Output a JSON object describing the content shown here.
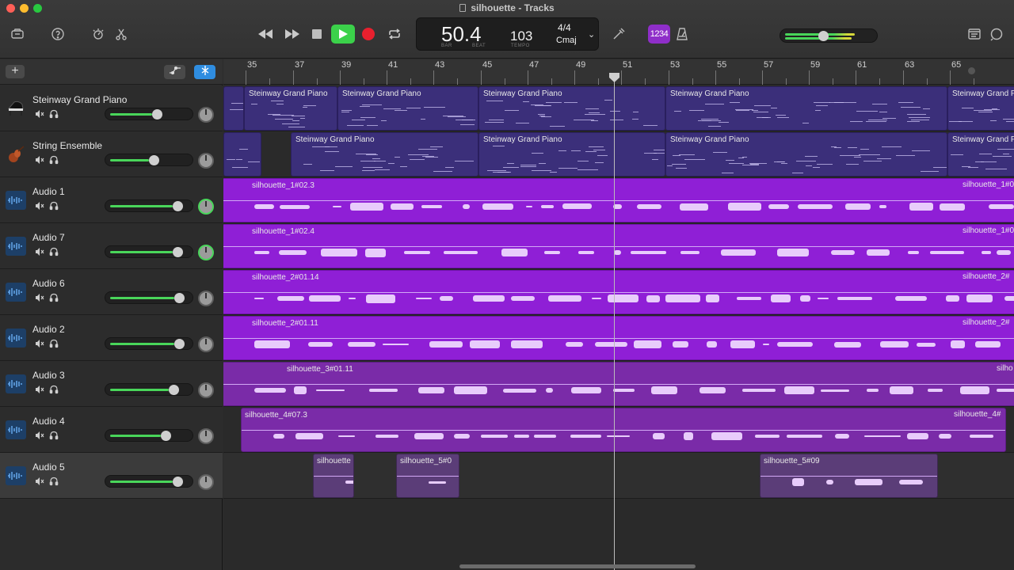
{
  "window": {
    "title": "silhouette - Tracks"
  },
  "colors": {
    "accent_green": "#3bd14a",
    "record_red": "#e8202e",
    "audio_region": "#8f1fd6",
    "midi_region": "#3b2f7a",
    "smart_blue": "#2f8de0"
  },
  "toolbar": {
    "lcd": {
      "position": "50.4",
      "bar_label": "BAR",
      "beat_label": "BEAT",
      "tempo": "103",
      "tempo_label": "TEMPO",
      "time_signature": "4/4",
      "key": "Cmaj"
    },
    "count_in": "1234",
    "master_volume": 0.4
  },
  "ruler": {
    "bars": [
      "35",
      "37",
      "39",
      "41",
      "43",
      "45",
      "47",
      "49",
      "51",
      "53",
      "55",
      "57",
      "59",
      "61",
      "63",
      "65"
    ]
  },
  "tracks": [
    {
      "name": "Steinway Grand Piano",
      "type": "piano",
      "volume": 0.6
    },
    {
      "name": "String Ensemble",
      "type": "strings",
      "volume": 0.55
    },
    {
      "name": "Audio 1",
      "type": "audio",
      "volume": 0.88
    },
    {
      "name": "Audio 7",
      "type": "audio",
      "volume": 0.88
    },
    {
      "name": "Audio 6",
      "type": "audio",
      "volume": 0.9
    },
    {
      "name": "Audio 2",
      "type": "audio",
      "volume": 0.9
    },
    {
      "name": "Audio 3",
      "type": "audio",
      "volume": 0.83
    },
    {
      "name": "Audio 4",
      "type": "audio",
      "volume": 0.72
    },
    {
      "name": "Audio 5",
      "type": "audio",
      "volume": 0.88
    }
  ],
  "regions": {
    "piano": [
      "Steinway Grand Piano",
      "Steinway Grand Piano",
      "Steinway Grand Piano",
      "Steinway Grand Piano",
      "Steinway Grand Piano"
    ],
    "strings": [
      "Steinway Grand Piano",
      "Steinway Grand Piano",
      "Steinway Grand Piano",
      "Steinway Grand Piano"
    ],
    "audio1": [
      "silhouette_1#02.3",
      "silhouette_1#0"
    ],
    "audio7": [
      "silhouette_1#02.4",
      "silhouette_1#0"
    ],
    "audio6": [
      "silhouette_2#01.14",
      "silhouette_2#"
    ],
    "audio2": [
      "silhouette_2#01.11",
      "silhouette_2#"
    ],
    "audio3": [
      "silhouette_3#01.11",
      "silho"
    ],
    "audio4": [
      "silhouette_4#07.3",
      "silhouette_4#"
    ],
    "audio5": [
      "silhouette",
      "silhouette_5#0",
      "silhouette_5#09"
    ]
  }
}
